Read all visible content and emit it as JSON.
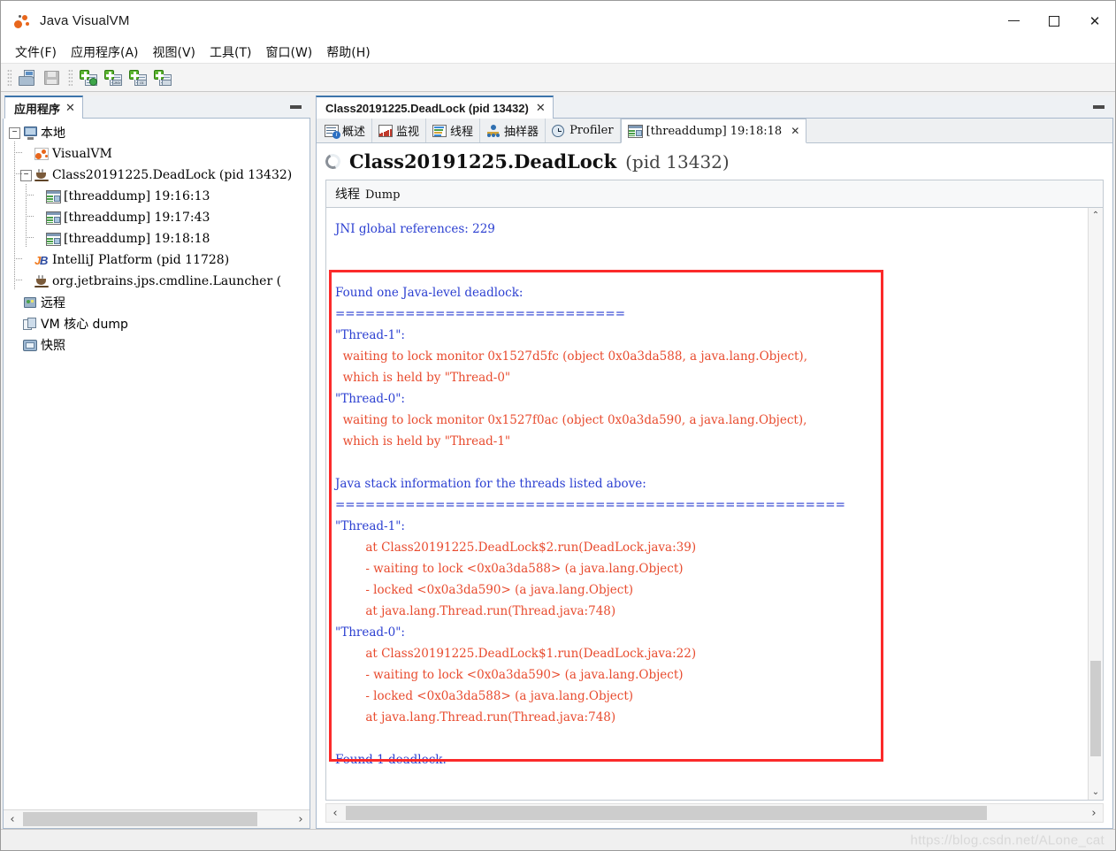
{
  "window": {
    "title": "Java VisualVM",
    "app_icon": "visualvm-icon",
    "controls": {
      "minimize": "—",
      "maximize": "☐",
      "close": "✕"
    }
  },
  "menubar": [
    {
      "label": "文件(F)",
      "name": "menu-file"
    },
    {
      "label": "应用程序(A)",
      "name": "menu-applications"
    },
    {
      "label": "视图(V)",
      "name": "menu-view"
    },
    {
      "label": "工具(T)",
      "name": "menu-tools"
    },
    {
      "label": "窗口(W)",
      "name": "menu-window"
    },
    {
      "label": "帮助(H)",
      "name": "menu-help"
    }
  ],
  "toolbar": {
    "buttons": [
      {
        "name": "open-file-button",
        "icon": "open-folder-icon",
        "tag": ""
      },
      {
        "name": "save-button",
        "icon": "save-disk-icon",
        "tag": ""
      },
      {
        "name": "add-remote-host-button",
        "icon": "add-host-icon",
        "tag": ""
      },
      {
        "name": "add-jmx-connection-button",
        "icon": "add-jmx-icon",
        "tag": "JMX"
      },
      {
        "name": "add-vm-coredump-button",
        "icon": "add-coredump-icon",
        "tag": "01"
      },
      {
        "name": "add-snapshot-button",
        "icon": "add-snapshot-icon",
        "tag": ""
      }
    ]
  },
  "left_panel": {
    "tab_label": "应用程序",
    "tab_close": "✕",
    "minimize": "minimize-icon",
    "tree": [
      {
        "label": "本地",
        "icon": "monitor-icon",
        "depth": 0,
        "expander": "−",
        "cjk": true,
        "name": "tree-node-local"
      },
      {
        "label": "VisualVM",
        "icon": "visualvm-icon",
        "depth": 1,
        "expander": "",
        "cjk": false,
        "name": "tree-node-visualvm"
      },
      {
        "label": "Class20191225.DeadLock (pid 13432)",
        "icon": "java-cup-icon",
        "depth": 1,
        "expander": "−",
        "cjk": false,
        "name": "tree-node-deadlock-process"
      },
      {
        "label": "[threaddump] 19:16:13",
        "icon": "threaddump-icon",
        "depth": 2,
        "expander": "",
        "cjk": false,
        "name": "tree-node-threaddump-191613"
      },
      {
        "label": "[threaddump] 19:17:43",
        "icon": "threaddump-icon",
        "depth": 2,
        "expander": "",
        "cjk": false,
        "name": "tree-node-threaddump-191743"
      },
      {
        "label": "[threaddump] 19:18:18",
        "icon": "threaddump-icon",
        "depth": 2,
        "expander": "",
        "cjk": false,
        "name": "tree-node-threaddump-191818"
      },
      {
        "label": "IntelliJ Platform (pid 11728)",
        "icon": "intellij-icon",
        "depth": 1,
        "expander": "",
        "cjk": false,
        "name": "tree-node-intellij-platform"
      },
      {
        "label": "org.jetbrains.jps.cmdline.Launcher (",
        "icon": "java-cup-icon",
        "depth": 1,
        "expander": "",
        "cjk": false,
        "name": "tree-node-jps-launcher"
      },
      {
        "label": "远程",
        "icon": "remote-icon",
        "depth": 0,
        "expander": "",
        "cjk": true,
        "name": "tree-node-remote"
      },
      {
        "label": "VM 核心 dump",
        "icon": "coredump-icon",
        "depth": 0,
        "expander": "",
        "cjk": true,
        "name": "tree-node-vm-coredump"
      },
      {
        "label": "快照",
        "icon": "snapshot-icon",
        "depth": 0,
        "expander": "",
        "cjk": true,
        "name": "tree-node-snapshots"
      }
    ],
    "hscroll": {
      "left_arrow": "‹",
      "right_arrow": "›"
    }
  },
  "right_panel": {
    "tab_label": "Class20191225.DeadLock (pid 13432)",
    "tab_close": "✕",
    "minimize": "minimize-icon",
    "sub_tabs": [
      {
        "label": "概述",
        "icon": "overview-icon",
        "active": false,
        "mono": false,
        "name": "tab-overview"
      },
      {
        "label": "监视",
        "icon": "monitor-chart-icon",
        "active": false,
        "mono": false,
        "name": "tab-monitor"
      },
      {
        "label": "线程",
        "icon": "threads-icon",
        "active": false,
        "mono": false,
        "name": "tab-threads"
      },
      {
        "label": "抽样器",
        "icon": "sampler-icon",
        "active": false,
        "mono": false,
        "name": "tab-sampler"
      },
      {
        "label": "Profiler",
        "icon": "profiler-clock-icon",
        "active": false,
        "mono": true,
        "name": "tab-profiler"
      },
      {
        "label": "[threaddump] 19:18:18",
        "icon": "threaddump-icon",
        "active": true,
        "mono": true,
        "closable": true,
        "close": "✕",
        "name": "tab-threaddump-191818"
      }
    ],
    "header": {
      "spinner": "loading-spinner-icon",
      "title": "Class20191225.DeadLock",
      "pid": "(pid 13432)"
    },
    "section_header": {
      "cjk": "线程",
      "en": "Dump"
    },
    "vscroll": {
      "up_arrow": "⌃",
      "down_arrow": "⌄"
    },
    "hscroll": {
      "left_arrow": "‹",
      "right_arrow": "›"
    }
  },
  "dump": {
    "preamble": [
      {
        "text": "JNI global references: 229",
        "color": "blue"
      },
      {
        "text": "",
        "color": "blue"
      },
      {
        "text": "",
        "color": "blue"
      }
    ],
    "boxed": [
      {
        "text": "Found one Java-level deadlock:",
        "color": "blue"
      },
      {
        "text": "=============================",
        "color": "blue"
      },
      {
        "text": "\"Thread-1\":",
        "color": "blue"
      },
      {
        "text": "  waiting to lock monitor 0x1527d5fc (object 0x0a3da588, a java.lang.Object),",
        "color": "red"
      },
      {
        "text": "  which is held by \"Thread-0\"",
        "color": "red"
      },
      {
        "text": "\"Thread-0\":",
        "color": "blue"
      },
      {
        "text": "  waiting to lock monitor 0x1527f0ac (object 0x0a3da590, a java.lang.Object),",
        "color": "red"
      },
      {
        "text": "  which is held by \"Thread-1\"",
        "color": "red"
      },
      {
        "text": "",
        "color": "blue"
      },
      {
        "text": "Java stack information for the threads listed above:",
        "color": "blue"
      },
      {
        "text": "===================================================",
        "color": "blue"
      },
      {
        "text": "\"Thread-1\":",
        "color": "blue"
      },
      {
        "text": "        at Class20191225.DeadLock$2.run(DeadLock.java:39)",
        "color": "red"
      },
      {
        "text": "        - waiting to lock <0x0a3da588> (a java.lang.Object)",
        "color": "red"
      },
      {
        "text": "        - locked <0x0a3da590> (a java.lang.Object)",
        "color": "red"
      },
      {
        "text": "        at java.lang.Thread.run(Thread.java:748)",
        "color": "red"
      },
      {
        "text": "\"Thread-0\":",
        "color": "blue"
      },
      {
        "text": "        at Class20191225.DeadLock$1.run(DeadLock.java:22)",
        "color": "red"
      },
      {
        "text": "        - waiting to lock <0x0a3da590> (a java.lang.Object)",
        "color": "red"
      },
      {
        "text": "        - locked <0x0a3da588> (a java.lang.Object)",
        "color": "red"
      },
      {
        "text": "        at java.lang.Thread.run(Thread.java:748)",
        "color": "red"
      },
      {
        "text": "",
        "color": "blue"
      },
      {
        "text": "Found 1 deadlock.",
        "color": "blue"
      }
    ],
    "highlight_color": "#fb2a2a"
  },
  "statusbar": {
    "watermark": "https://blog.csdn.net/ALone_cat"
  }
}
